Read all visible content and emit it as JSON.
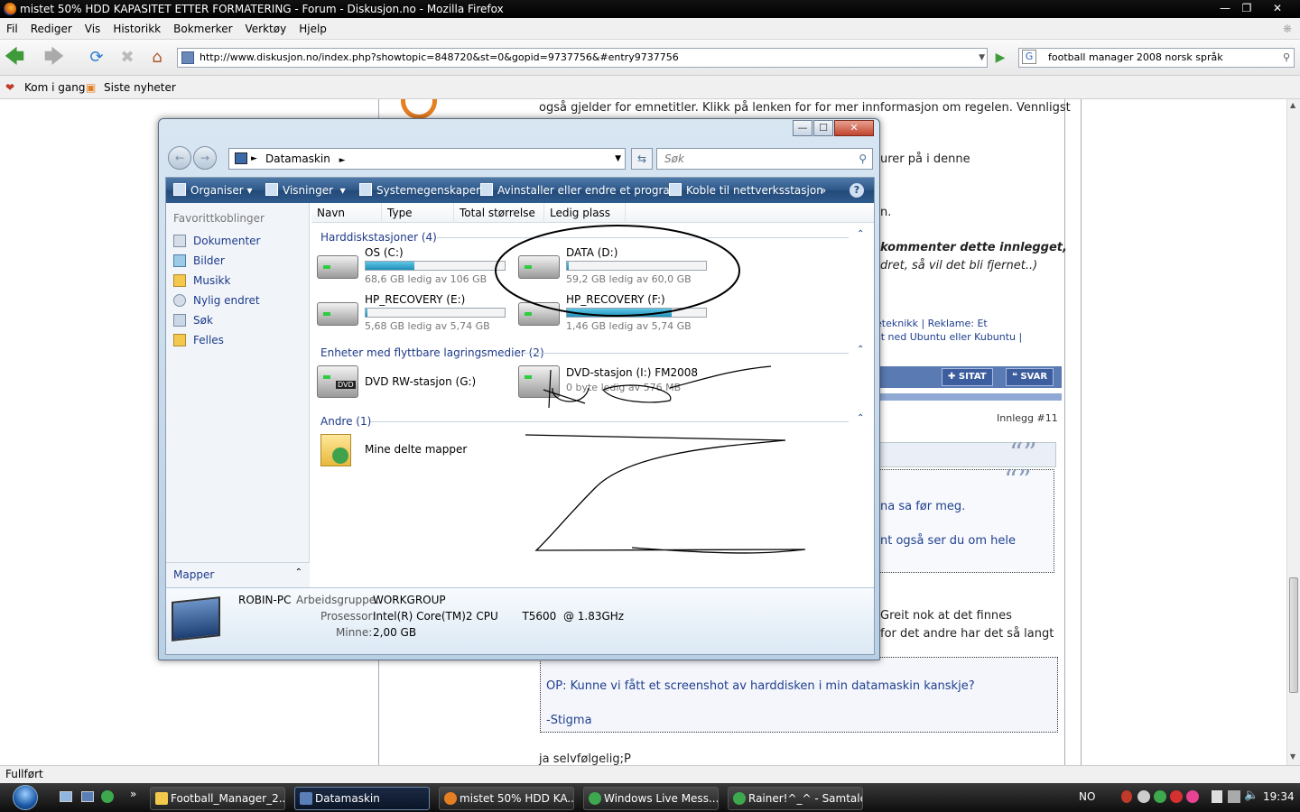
{
  "firefox": {
    "window_title": "mistet 50% HDD KAPASITET ETTER FORMATERING - Forum - Diskusjon.no - Mozilla Firefox",
    "menu": [
      "Fil",
      "Rediger",
      "Vis",
      "Historikk",
      "Bokmerker",
      "Verktøy",
      "Hjelp"
    ],
    "url": "http://www.diskusjon.no/index.php?showtopic=848720&st=0&gopid=9737756&#entry9737756",
    "search_value": "football manager 2008 norsk språk",
    "bookmarks": [
      "Kom i gang",
      "Siste nyheter"
    ],
    "status": "Fullført"
  },
  "webpage": {
    "line1": "også gjelder for emnetitler. Klikk på lenken for for mer innformasjon om regelen. Vennligst",
    "line2": "urer på i denne",
    "line3": "n.",
    "bold_line1": "kommenter dette innlegget,",
    "bold_line2": "dret, så vil det bli fjernet..)",
    "sig_line1": "eteknikk | Reklame: Et",
    "sig_line2": "st ned Ubuntu eller Kubuntu |",
    "btn_sitat": "SITAT",
    "btn_svar": "SVAR",
    "post_number": "Innlegg #11",
    "quote_text1": "na sa før meg.",
    "quote_text2": "nt også ser du om hele",
    "reply1": "Greit nok at det finnes",
    "reply2": "for det andre har det så langt",
    "quote2_line1": "OP: Kunne vi fått et screenshot av harddisken i min datamaskin kanskje?",
    "quote2_line2": "-Stigma",
    "last_line": "ja selvfølgelig;P"
  },
  "explorer": {
    "breadcrumb": "Datamaskin",
    "search_placeholder": "Søk",
    "toolbar": {
      "organiser": "Organiser",
      "visninger": "Visninger",
      "systemegenskaper": "Systemegenskaper",
      "avinstaller": "Avinstaller eller endre et program",
      "koble": "Koble til nettverksstasjon"
    },
    "nav": {
      "header": "Favorittkoblinger",
      "items": [
        "Dokumenter",
        "Bilder",
        "Musikk",
        "Nylig endret",
        "Søk",
        "Felles"
      ],
      "folders": "Mapper"
    },
    "columns": [
      "Navn",
      "Type",
      "Total størrelse",
      "Ledig plass"
    ],
    "groups": {
      "hdd": "Harddiskstasjoner (4)",
      "removable": "Enheter med flyttbare lagringsmedier (2)",
      "other": "Andre (1)"
    },
    "drives": [
      {
        "name": "OS (C:)",
        "free": "68,6 GB ledig av 106 GB",
        "used_fraction": 0.35
      },
      {
        "name": "DATA (D:)",
        "free": "59,2 GB ledig av 60,0 GB",
        "used_fraction": 0.013
      },
      {
        "name": "HP_RECOVERY (E:)",
        "free": "5,68 GB ledig av 5,74 GB",
        "used_fraction": 0.01
      },
      {
        "name": "HP_RECOVERY (F:)",
        "free": "1,46 GB ledig av 5,74 GB",
        "used_fraction": 0.75
      }
    ],
    "removable": [
      {
        "name": "DVD RW-stasjon (G:)"
      },
      {
        "name": "DVD-stasjon (I:) FM2008",
        "free": "0 byte ledig av 576 MB"
      }
    ],
    "other_items": [
      "Mine delte mapper"
    ],
    "details": {
      "computer": "ROBIN-PC",
      "workgroup_label": "Arbeidsgruppe:",
      "workgroup": "WORKGROUP",
      "cpu_label": "Prosessor:",
      "cpu": "Intel(R) Core(TM)2 CPU       T5600  @ 1.83GHz",
      "mem_label": "Minne:",
      "mem": "2,00 GB"
    }
  },
  "taskbar": {
    "items": [
      "Football_Manager_2...",
      "Datamaskin",
      "mistet 50% HDD KA...",
      "Windows Live Mess...",
      "Rainer!^_^ - Samtale"
    ],
    "lang": "NO",
    "clock": "19:34"
  },
  "colors": {
    "accent": "#2c5687",
    "link": "#1e3a8a",
    "bar_fill": "#1f8fb8"
  }
}
